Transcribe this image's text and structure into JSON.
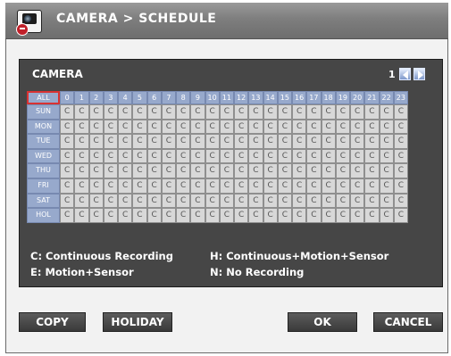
{
  "window": {
    "title": "CAMERA > SCHEDULE"
  },
  "panel": {
    "label": "CAMERA",
    "camera_number": "1"
  },
  "grid": {
    "corner": "ALL",
    "hours": [
      "0",
      "1",
      "2",
      "3",
      "4",
      "5",
      "6",
      "7",
      "8",
      "9",
      "10",
      "11",
      "12",
      "13",
      "14",
      "15",
      "16",
      "17",
      "18",
      "19",
      "20",
      "21",
      "22",
      "23"
    ],
    "days": [
      "SUN",
      "MON",
      "TUE",
      "WED",
      "THU",
      "FRI",
      "SAT",
      "HOL"
    ],
    "cell_value": "C"
  },
  "legend": {
    "c": "C: Continuous Recording",
    "h": "H: Continuous+Motion+Sensor",
    "e": "E: Motion+Sensor",
    "n": "N: No Recording"
  },
  "buttons": {
    "copy": "COPY",
    "holiday": "HOLIDAY",
    "ok": "OK",
    "cancel": "CANCEL"
  },
  "icons": {
    "title": "camera-settings-icon",
    "prev": "prev-arrow-icon",
    "next": "next-arrow-icon"
  }
}
